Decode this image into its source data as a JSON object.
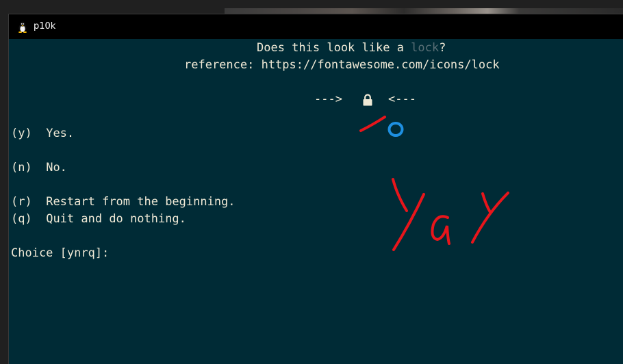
{
  "window": {
    "title": "p10k",
    "app_icon": "tux-icon"
  },
  "prompt": {
    "question_prefix": "Does this look like a ",
    "question_word": "lock",
    "question_suffix": "?",
    "reference": "reference: https://fontawesome.com/icons/lock",
    "arrow_left": "--->",
    "arrow_right": "<---",
    "glyph": "lock-icon"
  },
  "options": [
    {
      "key": "(y)",
      "label": "Yes."
    },
    {
      "key": "(n)",
      "label": "No."
    },
    {
      "key": "(r)",
      "label": "Restart from the beginning."
    },
    {
      "key": "(q)",
      "label": "Quit and do nothing."
    }
  ],
  "choice_prompt": "Choice [ynrq]:",
  "colors": {
    "terminal_bg": "#002b36",
    "terminal_fg": "#eee8d5",
    "dim_word": "#586e75",
    "annotation_red": "#e8151b",
    "cursor_blue": "#1e8fe0"
  }
}
